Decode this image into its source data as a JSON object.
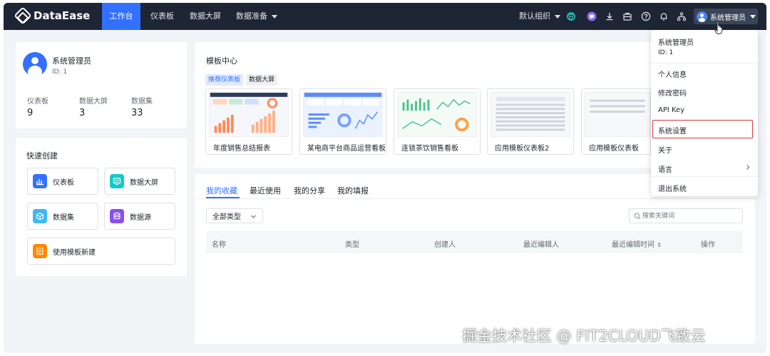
{
  "app": {
    "logo_text": "DataEase"
  },
  "nav": {
    "items": [
      {
        "label": "工作台",
        "active": true
      },
      {
        "label": "仪表板"
      },
      {
        "label": "数据大屏"
      },
      {
        "label": "数据准备"
      }
    ],
    "org_selector": "默认组织",
    "user_name": "系统管理员"
  },
  "profile": {
    "name": "系统管理员",
    "id_text": "ID: 1",
    "stats": [
      {
        "label": "仪表板",
        "value": "9"
      },
      {
        "label": "数据大屏",
        "value": "3"
      },
      {
        "label": "数据集",
        "value": "33"
      }
    ]
  },
  "quick_create": {
    "title": "快速创建",
    "items": [
      {
        "label": "仪表板",
        "color": "#3370ff"
      },
      {
        "label": "数据大屏",
        "color": "#14c9c9"
      },
      {
        "label": "数据集",
        "color": "#3bb9f5"
      },
      {
        "label": "数据源",
        "color": "#8b4fed"
      },
      {
        "label": "使用模板新建",
        "color": "#ff8800"
      }
    ]
  },
  "template_center": {
    "title": "模板中心",
    "chips": [
      "推荐仪表板",
      "数据大屏"
    ],
    "cards": [
      "年度销售总结报表",
      "某电商平台商品运营看板",
      "连锁茶饮销售看板",
      "应用模板仪表板2",
      "应用模板仪表板"
    ]
  },
  "tabs": [
    "我的收藏",
    "最近使用",
    "我的分享",
    "我的填报"
  ],
  "filter": {
    "type_select": "全部类型",
    "search_placeholder": "搜索关键词"
  },
  "table": {
    "columns": [
      "名称",
      "类型",
      "创建人",
      "最近编辑人",
      "最近编辑时间",
      "操作"
    ]
  },
  "user_menu": {
    "name": "系统管理员",
    "id_text": "ID: 1",
    "items": [
      "个人信息",
      "修改密码",
      "API Key",
      "系统设置",
      "关于",
      "语言",
      "退出系统"
    ],
    "highlighted": "系统设置"
  },
  "watermark": "掘金技术社区 @ FIT2CLOUD飞致云",
  "colors": {
    "nav_bg": "#1e2535",
    "accent": "#3370ff",
    "highlight_border": "#d83a3a"
  }
}
